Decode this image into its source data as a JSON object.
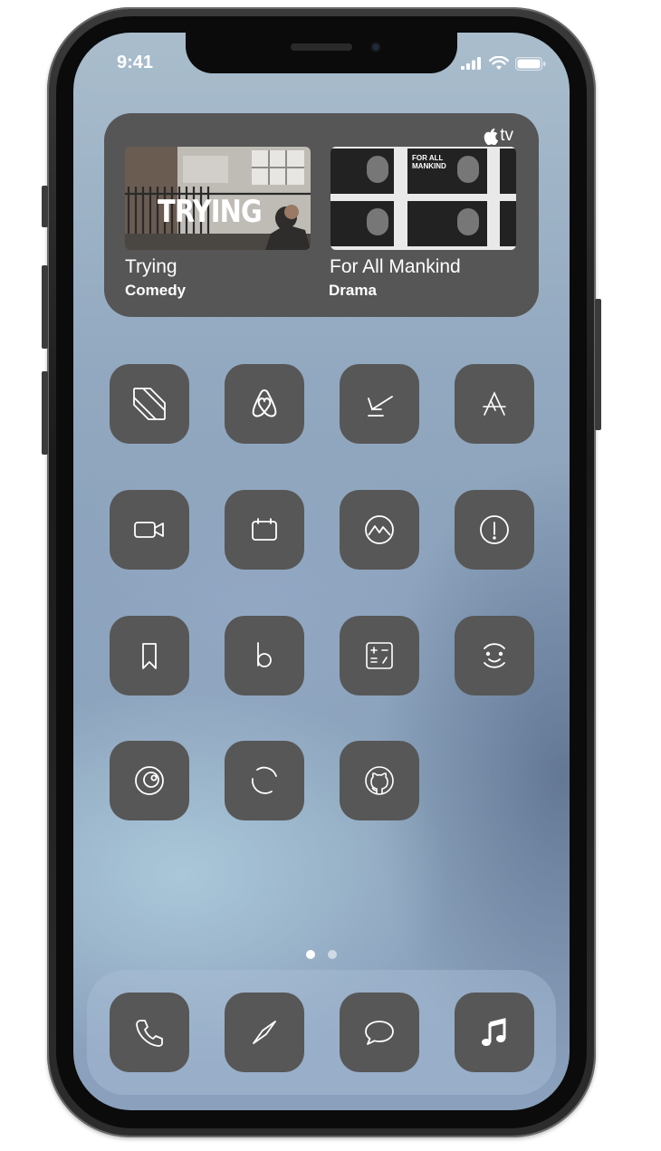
{
  "status_bar": {
    "time": "9:41",
    "icons": [
      "signal-icon",
      "wifi-icon",
      "battery-icon"
    ]
  },
  "widget": {
    "brand": "tv",
    "items": [
      {
        "thumbnail_text": "TRYING",
        "title": "Trying",
        "genre": "Comedy"
      },
      {
        "thumbnail_text": "FOR ALL MANKIND",
        "title": "For All Mankind",
        "genre": "Drama"
      }
    ]
  },
  "apps": [
    [
      "news-icon",
      "airbnb-icon",
      "notes-signature-icon",
      "app-store-icon"
    ],
    [
      "facetime-icon",
      "calendar-icon",
      "photos-mountain-icon",
      "info-icon"
    ],
    [
      "bookmark-icon",
      "bold-b-icon",
      "calculator-icon",
      "face-icon"
    ],
    [
      "crunchyroll-icon",
      "loading-circle-icon",
      "github-icon"
    ]
  ],
  "page_indicator": {
    "pages": 2,
    "current": 1
  },
  "dock": [
    "phone-icon",
    "safari-compass-icon",
    "messages-icon",
    "music-icon"
  ],
  "colors": {
    "icon_bg": "#575757",
    "widget_bg": "#565656",
    "glyph": "#ffffff"
  }
}
